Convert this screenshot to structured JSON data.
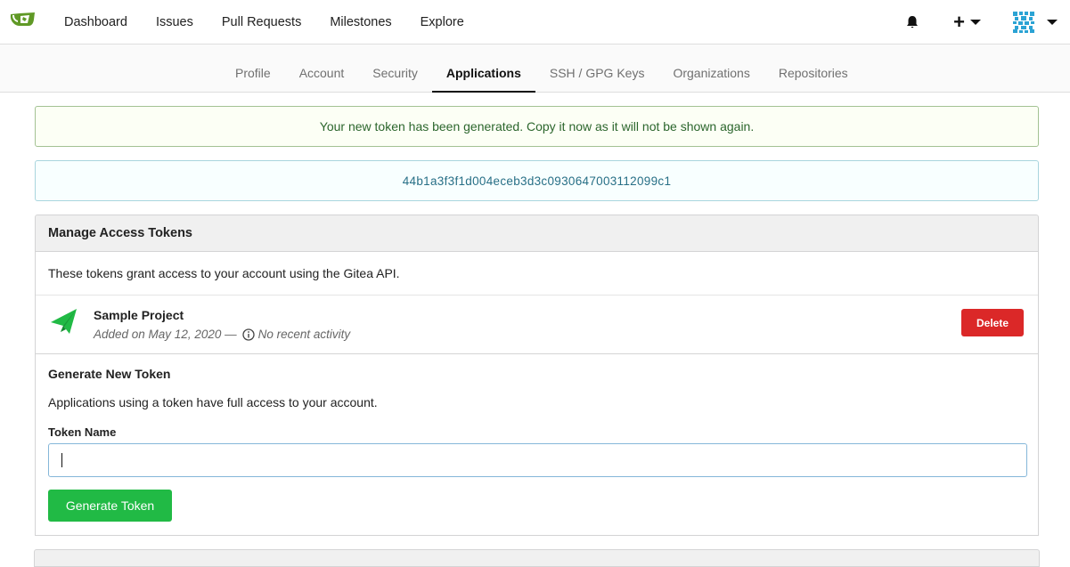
{
  "nav": {
    "items": [
      "Dashboard",
      "Issues",
      "Pull Requests",
      "Milestones",
      "Explore"
    ],
    "brand_color": "#609926"
  },
  "settings_tabs": {
    "items": [
      "Profile",
      "Account",
      "Security",
      "Applications",
      "SSH / GPG Keys",
      "Organizations",
      "Repositories"
    ],
    "active": "Applications"
  },
  "messages": {
    "success": "Your new token has been generated. Copy it now as it will not be shown again.",
    "token_value": "44b1a3f3f1d004eceb3d3c0930647003112099c1"
  },
  "tokens": {
    "header": "Manage Access Tokens",
    "description": "These tokens grant access to your account using the Gitea API.",
    "list": [
      {
        "name": "Sample Project",
        "added": "Added on May 12, 2020 —",
        "activity": "No recent activity",
        "delete_label": "Delete"
      }
    ]
  },
  "generate": {
    "title": "Generate New Token",
    "description": "Applications using a token have full access to your account.",
    "field_label": "Token Name",
    "field_value": "",
    "button_label": "Generate Token"
  },
  "colors": {
    "success_text": "#2c662d",
    "info_text": "#276f86",
    "danger": "#db2828",
    "primary_green": "#21ba45"
  }
}
